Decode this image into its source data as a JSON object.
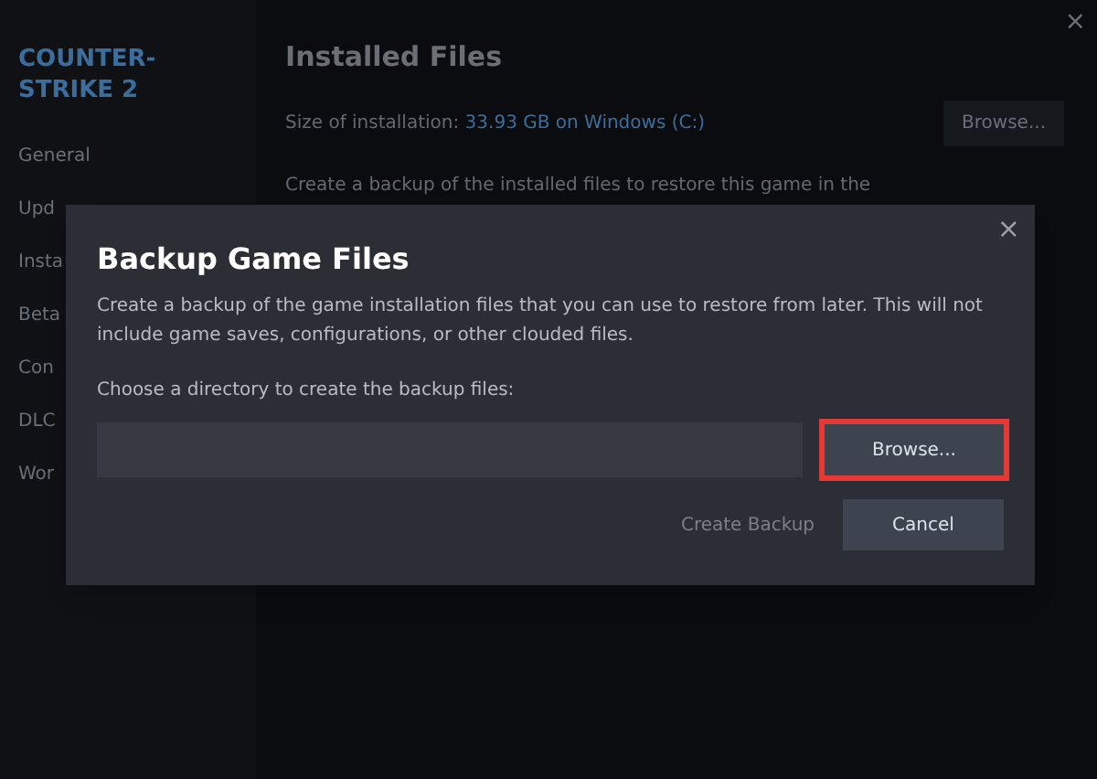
{
  "sidebar": {
    "title": "COUNTER-STRIKE 2",
    "items": [
      {
        "label": "General"
      },
      {
        "label": "Upd"
      },
      {
        "label": "Insta"
      },
      {
        "label": "Beta"
      },
      {
        "label": "Con"
      },
      {
        "label": "DLC"
      },
      {
        "label": "Wor"
      }
    ]
  },
  "main": {
    "title": "Installed Files",
    "size_label": "Size of installation:",
    "size_value": "33.93 GB on Windows (C:)",
    "browse": "Browse...",
    "backup_text": "Create a backup of the installed files to restore this game in the"
  },
  "window_close": "×",
  "dialog": {
    "title": "Backup Game Files",
    "close": "×",
    "description": "Create a backup of the game installation files that you can use to restore from later. This will not include game saves, configurations, or other clouded files.",
    "field_label": "Choose a directory to create the backup files:",
    "browse": {
      "label": "Browse...",
      "highlighted": true
    },
    "buttons": [
      {
        "label": "Create Backup",
        "disabled": true
      },
      {
        "label": "Cancel",
        "disabled": false
      }
    ]
  }
}
